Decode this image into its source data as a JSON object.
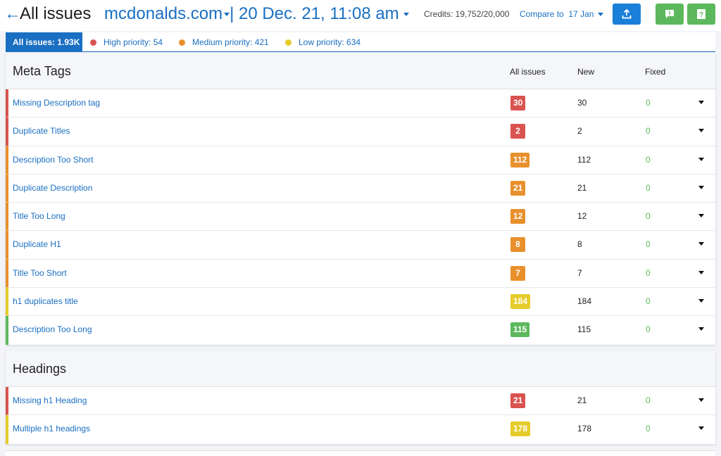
{
  "header": {
    "back_glyph": "←",
    "title": "All issues",
    "domain": "mcdonalds.com",
    "separator_date": "| 20 Dec. 21, 11:08 am",
    "credits": "Credits: 19,752/20,000",
    "compare": "Compare to  17 Jan"
  },
  "tabs": {
    "all": "All issues: 1.93K",
    "high": "High priority: 54",
    "medium": "Medium priority: 421",
    "low": "Low priority: 634"
  },
  "colors": {
    "high": "#d9534f",
    "medium": "#e8902c",
    "low": "#e6cc2a",
    "good": "#5cb85c",
    "accent": "#1a6fc2"
  },
  "columns": {
    "all": "All issues",
    "new": "New",
    "fixed": "Fixed"
  },
  "sections": [
    {
      "title": "Meta Tags",
      "rows": [
        {
          "name": "Missing Description tag",
          "all": "30",
          "new": "30",
          "fixed": "0",
          "priority": "high"
        },
        {
          "name": "Duplicate Titles",
          "all": "2",
          "new": "2",
          "fixed": "0",
          "priority": "high"
        },
        {
          "name": "Description Too Short",
          "all": "112",
          "new": "112",
          "fixed": "0",
          "priority": "medium"
        },
        {
          "name": "Duplicate Description",
          "all": "21",
          "new": "21",
          "fixed": "0",
          "priority": "medium"
        },
        {
          "name": "Title Too Long",
          "all": "12",
          "new": "12",
          "fixed": "0",
          "priority": "medium"
        },
        {
          "name": "Duplicate H1",
          "all": "8",
          "new": "8",
          "fixed": "0",
          "priority": "medium"
        },
        {
          "name": "Title Too Short",
          "all": "7",
          "new": "7",
          "fixed": "0",
          "priority": "medium"
        },
        {
          "name": "h1 duplicates title",
          "all": "184",
          "new": "184",
          "fixed": "0",
          "priority": "low"
        },
        {
          "name": "Description Too Long",
          "all": "115",
          "new": "115",
          "fixed": "0",
          "priority": "good"
        }
      ]
    },
    {
      "title": "Headings",
      "rows": [
        {
          "name": "Missing h1 Heading",
          "all": "21",
          "new": "21",
          "fixed": "0",
          "priority": "high"
        },
        {
          "name": "Multiple h1 headings",
          "all": "178",
          "new": "178",
          "fixed": "0",
          "priority": "low"
        }
      ]
    }
  ]
}
